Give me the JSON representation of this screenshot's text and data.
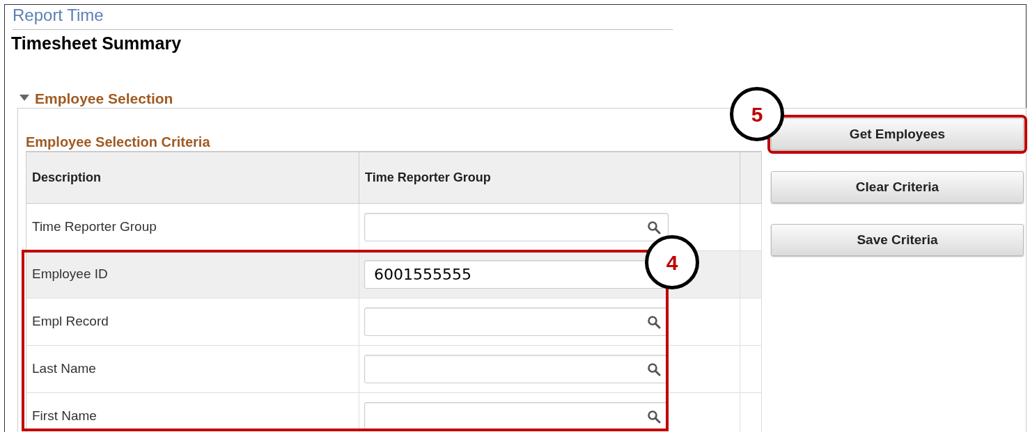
{
  "page": {
    "breadcrumb": "Report Time",
    "title": "Timesheet Summary"
  },
  "section": {
    "title": "Employee Selection",
    "expanded": true
  },
  "criteria": {
    "title": "Employee Selection Criteria",
    "columns": [
      "Description",
      "Time Reporter Group"
    ],
    "rows": [
      {
        "label": "Time Reporter Group",
        "value": "",
        "selected": false
      },
      {
        "label": "Employee ID",
        "value": "6001555555",
        "selected": true
      },
      {
        "label": "Empl Record",
        "value": "",
        "selected": false
      },
      {
        "label": "Last Name",
        "value": "",
        "selected": false
      },
      {
        "label": "First Name",
        "value": "",
        "selected": false
      }
    ]
  },
  "buttons": [
    {
      "label": "Get Employees",
      "highlighted": true
    },
    {
      "label": "Clear Criteria",
      "highlighted": false
    },
    {
      "label": "Save Criteria",
      "highlighted": false
    }
  ],
  "callouts": [
    {
      "label": "4",
      "kind": "frame"
    },
    {
      "label": "5",
      "kind": "circle"
    }
  ]
}
